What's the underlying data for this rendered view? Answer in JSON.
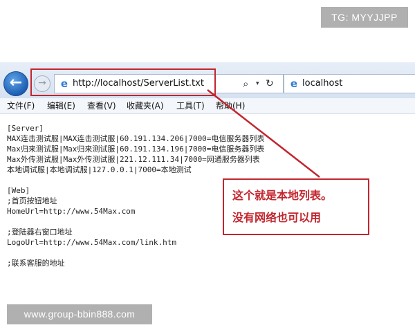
{
  "watermark_top": "TG: MYYJJPP",
  "watermark_bottom": "www.group-bbin888.com",
  "browser": {
    "url": "http://localhost/ServerList.txt",
    "tab_title": "localhost",
    "icons": [
      "back-icon",
      "forward-icon",
      "ie-icon",
      "search-icon",
      "dropdown-icon",
      "refresh-icon"
    ]
  },
  "menu": [
    "文件(F)",
    "编辑(E)",
    "查看(V)",
    "收藏夹(A)",
    "工具(T)",
    "帮助(H)"
  ],
  "file_lines": [
    "[Server]",
    "MAX连击测试服|MAX连击测试服|60.191.134.206|7000=电信服务器列表",
    "Max归来测试服|Max归来测试服|60.191.134.196|7000=电信服务器列表",
    "Max外传测试服|Max外传测试服|221.12.111.34|7000=网通服务器列表",
    "本地调试服|本地调试服|127.0.0.1|7000=本地测试",
    "",
    "[Web]",
    ";首页按钮地址",
    "HomeUrl=http://www.54Max.com",
    "",
    ";登陆器右窗口地址",
    "LogoUrl=http://www.54Max.com/link.htm",
    "",
    ";联系客服的地址"
  ],
  "callout": {
    "line1": "这个就是本地列表。",
    "line2": "没有网络也可以用"
  },
  "colors": {
    "annotation": "#c2262e",
    "toolbar": "#dde7f3",
    "back_button": "#1d5fb4"
  }
}
